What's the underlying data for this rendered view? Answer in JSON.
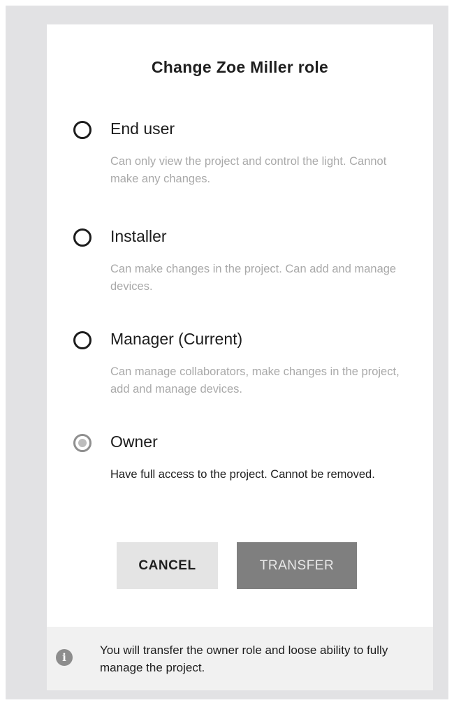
{
  "dialog": {
    "title": "Change Zoe Miller role"
  },
  "options": [
    {
      "label": "End user",
      "description": "Can only view the project and control the light. Cannot make any changes.",
      "selected": false
    },
    {
      "label": "Installer",
      "description": "Can make changes in the project. Can add and manage devices.",
      "selected": false
    },
    {
      "label": "Manager (Current)",
      "description": "Can manage collaborators, make changes in the project, add and manage devices.",
      "selected": false
    },
    {
      "label": "Owner",
      "description": "Have full access to the project. Cannot be removed.",
      "selected": true
    }
  ],
  "buttons": {
    "cancel_label": "CANCEL",
    "transfer_label": "TRANSFER"
  },
  "info": {
    "icon": "info-icon",
    "icon_glyph": "i",
    "text": "You will transfer the owner role and loose ability to fully manage the project."
  },
  "colors": {
    "frame_bg": "#e2e2e4",
    "dialog_bg": "#ffffff",
    "transfer_button_bg": "#7f7f7f",
    "cancel_button_bg": "#e4e4e4",
    "info_bar_bg": "#f1f1f1"
  }
}
